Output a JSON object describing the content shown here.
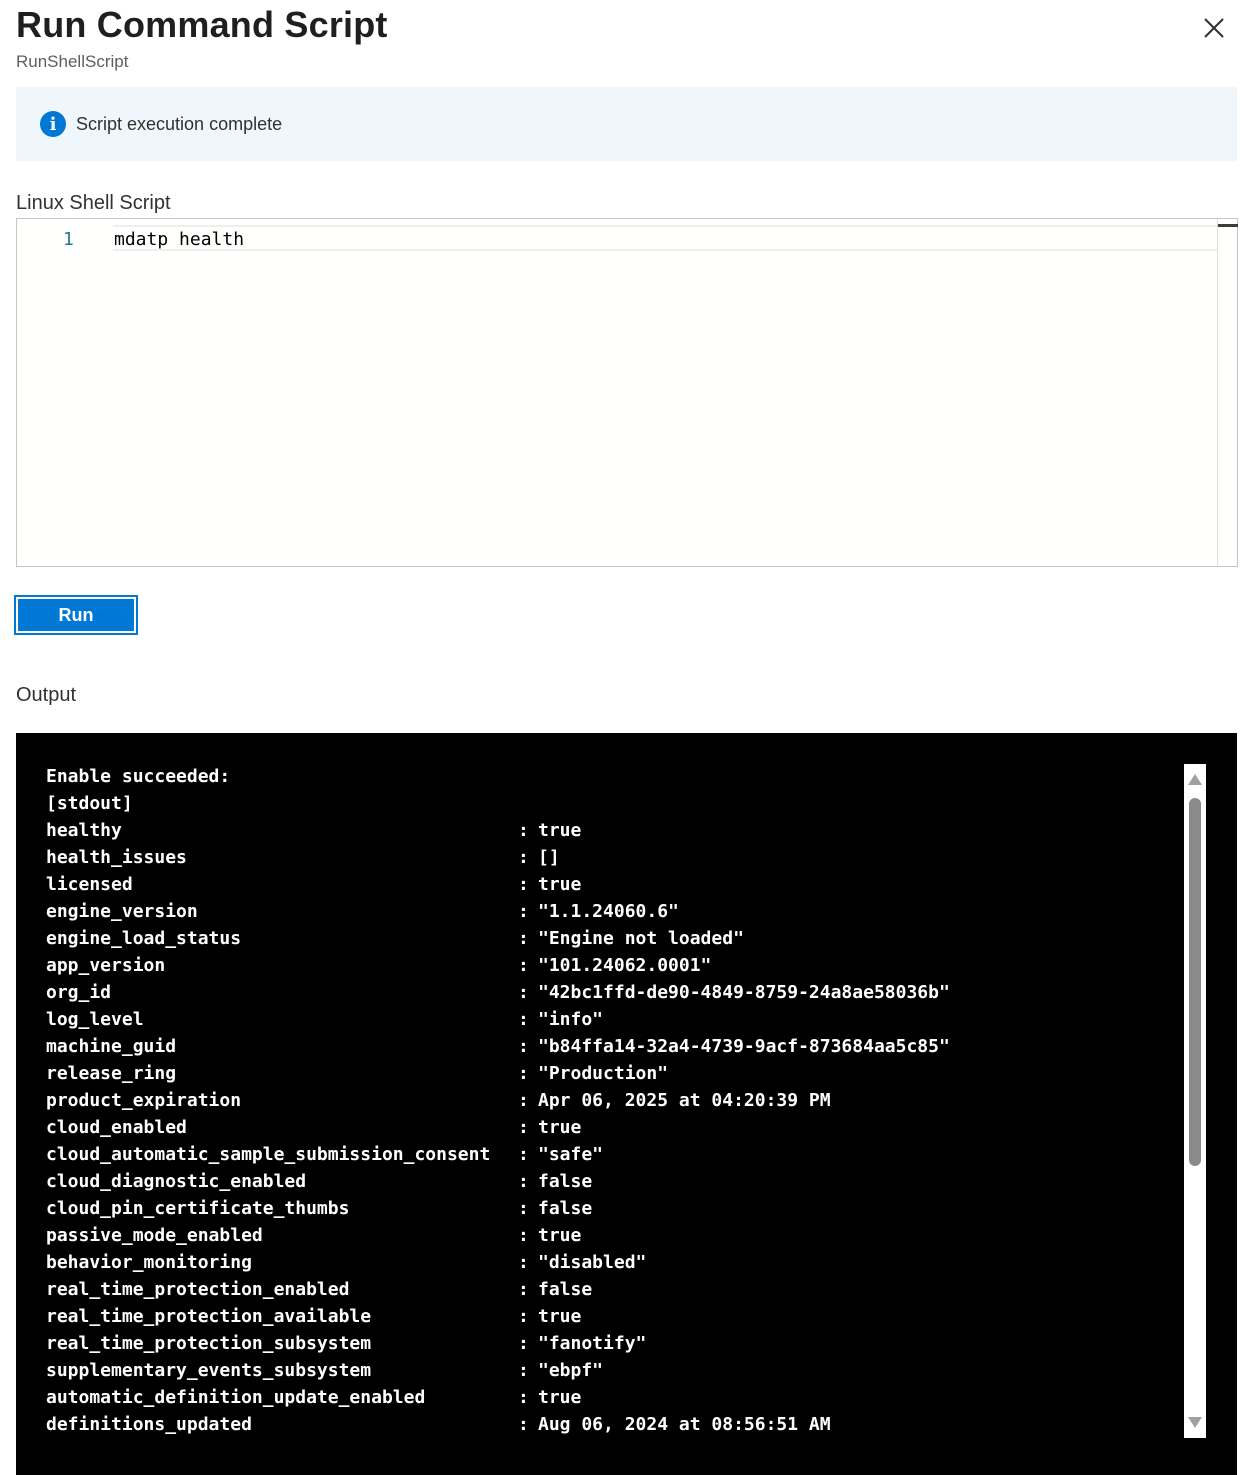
{
  "panel": {
    "title": "Run Command Script",
    "subtitle": "RunShellScript"
  },
  "info_bar": {
    "message": "Script execution complete",
    "icon": "info-icon",
    "accent": "#0078d4"
  },
  "script": {
    "label": "Linux Shell Script",
    "lines": [
      {
        "number": "1",
        "code": "mdatp health"
      }
    ]
  },
  "run_button": {
    "label": "Run"
  },
  "output": {
    "label": "Output",
    "header_lines": [
      "Enable succeeded:",
      "[stdout]"
    ],
    "rows": [
      {
        "key": "healthy",
        "value": "true"
      },
      {
        "key": "health_issues",
        "value": "[]"
      },
      {
        "key": "licensed",
        "value": "true"
      },
      {
        "key": "engine_version",
        "value": "\"1.1.24060.6\""
      },
      {
        "key": "engine_load_status",
        "value": "\"Engine not loaded\""
      },
      {
        "key": "app_version",
        "value": "\"101.24062.0001\""
      },
      {
        "key": "org_id",
        "value": "\"42bc1ffd-de90-4849-8759-24a8ae58036b\""
      },
      {
        "key": "log_level",
        "value": "\"info\""
      },
      {
        "key": "machine_guid",
        "value": "\"b84ffa14-32a4-4739-9acf-873684aa5c85\""
      },
      {
        "key": "release_ring",
        "value": "\"Production\""
      },
      {
        "key": "product_expiration",
        "value": "Apr 06, 2025 at 04:20:39 PM"
      },
      {
        "key": "cloud_enabled",
        "value": "true"
      },
      {
        "key": "cloud_automatic_sample_submission_consent",
        "value": "\"safe\""
      },
      {
        "key": "cloud_diagnostic_enabled",
        "value": "false"
      },
      {
        "key": "cloud_pin_certificate_thumbs",
        "value": "false"
      },
      {
        "key": "passive_mode_enabled",
        "value": "true"
      },
      {
        "key": "behavior_monitoring",
        "value": "\"disabled\""
      },
      {
        "key": "real_time_protection_enabled",
        "value": "false"
      },
      {
        "key": "real_time_protection_available",
        "value": "true"
      },
      {
        "key": "real_time_protection_subsystem",
        "value": "\"fanotify\""
      },
      {
        "key": "supplementary_events_subsystem",
        "value": "\"ebpf\""
      },
      {
        "key": "automatic_definition_update_enabled",
        "value": "true"
      },
      {
        "key": "definitions_updated",
        "value": "Aug 06, 2024 at 08:56:51 AM"
      }
    ],
    "separator": ":"
  },
  "icons": {
    "close": "close-icon",
    "scroll_up": "scroll-up-arrow-icon",
    "scroll_down": "scroll-down-arrow-icon"
  }
}
